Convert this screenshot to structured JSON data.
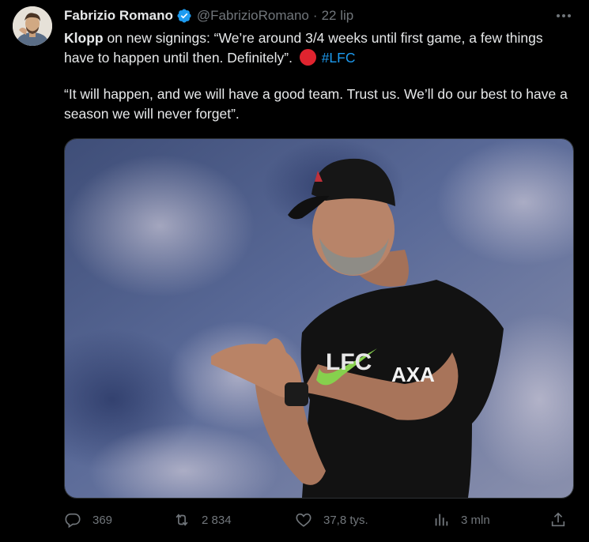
{
  "author": {
    "name": "Fabrizio Romano",
    "handle": "@FabrizioRomano",
    "separator": "·",
    "date": "22 lip"
  },
  "tweet": {
    "line1_bold": "Klopp",
    "line1_rest": " on new signings: “We’re around 3/4 weeks until first game, a few things have to happen until then. Definitely”. ",
    "hashtag": "#LFC",
    "paragraph2": "“It will happen, and we will have a good team. Trust us. We’ll do our best to have a season we will never forget”."
  },
  "media": {
    "jersey_text": "LFC",
    "sponsor_text": "AXA"
  },
  "actions": {
    "replies": "369",
    "retweets": "2 834",
    "likes": "37,8 tys.",
    "views": "3 mln"
  },
  "colors": {
    "background": "#000000",
    "text": "#e7e9ea",
    "secondary": "#71767b",
    "link": "#1d9bf0",
    "verified": "#1d9bf0",
    "red_circle": "#e0242f"
  }
}
